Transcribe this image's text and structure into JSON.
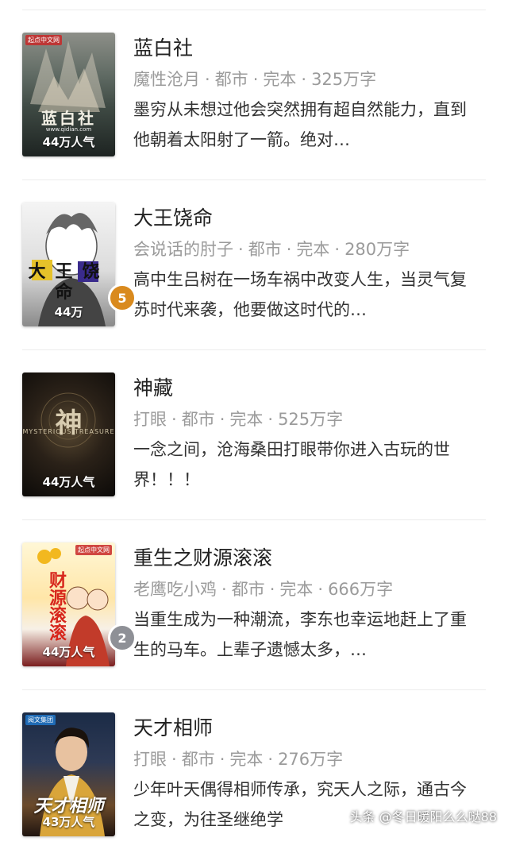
{
  "books": [
    {
      "title": "蓝白社",
      "author": "魔性沧月",
      "category": "都市",
      "status": "完本",
      "words": "325万字",
      "description": "墨穷从未想过他会突然拥有超自然能力，直到他朝着太阳射了一箭。绝对…",
      "cover_title": "蓝白社",
      "cover_popularity": "44万人气",
      "cover_publisher": "起点中文网",
      "cover_url": "www.qidian.com",
      "rank": ""
    },
    {
      "title": "大王饶命",
      "author": "会说话的肘子",
      "category": "都市",
      "status": "完本",
      "words": "280万字",
      "description": "高中生吕树在一场车祸中改变人生，当灵气复苏时代来袭，他要做这时代的…",
      "cover_title": "大王饶命",
      "cover_popularity": "44万",
      "cover_publisher": "",
      "cover_url": "",
      "rank": "5"
    },
    {
      "title": "神藏",
      "author": "打眼",
      "category": "都市",
      "status": "完本",
      "words": "525万字",
      "description": "一念之间，沧海桑田打眼带你进入古玩的世界！！！",
      "cover_title": "神",
      "cover_subtitle": "MYSTERIOUS TREASURE",
      "cover_popularity": "44万人气",
      "cover_publisher": "",
      "cover_url": "",
      "rank": ""
    },
    {
      "title": "重生之财源滚滚",
      "author": "老鹰吃小鸡",
      "category": "都市",
      "status": "完本",
      "words": "666万字",
      "description": "当重生成为一种潮流，李东也幸运地赶上了重生的马车。上辈子遗憾太多，…",
      "cover_title": "财源滚滚",
      "cover_popularity": "44万人气",
      "cover_publisher": "起点中文网",
      "cover_url": "",
      "rank": "2"
    },
    {
      "title": "天才相师",
      "author": "打眼",
      "category": "都市",
      "status": "完本",
      "words": "276万字",
      "description": "少年叶天偶得相师传承，究天人之际，通古今之变，为往圣继绝学",
      "cover_title": "天才相师",
      "cover_popularity": "43万人气",
      "cover_publisher": "阅文集团",
      "cover_url": "",
      "rank": ""
    }
  ],
  "separator": "·",
  "watermark": "头条 @冬日暖阳么么哒88",
  "colors": {
    "rank_gold": "#d98a1e",
    "rank_silver": "#8e9096"
  }
}
